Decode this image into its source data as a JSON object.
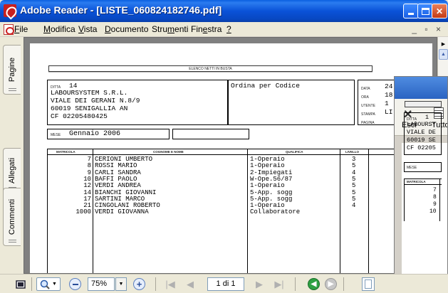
{
  "window": {
    "title": "Adobe Reader - [LISTE_060824182746.pdf]"
  },
  "menu": {
    "items": [
      {
        "prefix": "",
        "key": "F",
        "rest": "ile"
      },
      {
        "prefix": "",
        "key": "M",
        "rest": "odifica"
      },
      {
        "prefix": "",
        "key": "V",
        "rest": "ista"
      },
      {
        "prefix": "",
        "key": "D",
        "rest": "ocumento"
      },
      {
        "prefix": "Stru",
        "key": "m",
        "rest": "enti"
      },
      {
        "prefix": "Fin",
        "key": "e",
        "rest": "stra"
      },
      {
        "prefix": "",
        "key": "?",
        "rest": ""
      }
    ],
    "doc_controls": "_ ▫ ×"
  },
  "sidebar": {
    "tabs": [
      "Pagine",
      "Allegati",
      "Commenti"
    ]
  },
  "document": {
    "header_title": "ELENCO NETTI IN BUSTA",
    "ditta_label": "DITTA",
    "ditta_code": "14",
    "company_lines": [
      "LABOURSYSTEM S.R.L.",
      "VIALE DEI GERANI N.8/9",
      "60019 SENIGALLIA AN",
      "CF 02205480425"
    ],
    "ordina": "Ordina per Codice",
    "right_labels": [
      "DATA",
      "ORA",
      "UTENTE",
      "STAMPA",
      "PAGINA"
    ],
    "right_values": [
      "24",
      "18",
      "1",
      "LI",
      ""
    ],
    "mese_label": "MESE",
    "mese_value": "Gennaio  2006",
    "columns": {
      "matricola": "MATRICOLA",
      "nome": "COGNOME E NOME",
      "qualifica": "QUALIFICA",
      "livello": "LIVELLO"
    },
    "rows": [
      {
        "matricola": "7",
        "nome": "CERIONI UMBERTO",
        "qualifica": "1-Operaio",
        "livello": "3"
      },
      {
        "matricola": "8",
        "nome": "ROSSI MARIO",
        "qualifica": "1-Operaio",
        "livello": "5"
      },
      {
        "matricola": "9",
        "nome": "CARLI SANDRA",
        "qualifica": "2-Impiegati",
        "livello": "4"
      },
      {
        "matricola": "10",
        "nome": "BAFFI PAOLO",
        "qualifica": "W-Ope.56/87",
        "livello": "5"
      },
      {
        "matricola": "12",
        "nome": "VERDI ANDREA",
        "qualifica": "1-Operaio",
        "livello": "5"
      },
      {
        "matricola": "14",
        "nome": "BIANCHI GIOVANNI",
        "qualifica": "5-App. sogg",
        "livello": "5"
      },
      {
        "matricola": "17",
        "nome": "SARTINI MARCO",
        "qualifica": "5-App. sogg",
        "livello": "5"
      },
      {
        "matricola": "21",
        "nome": "CINGOLANI ROBERTO",
        "qualifica": "1-Operaio",
        "livello": "4"
      },
      {
        "matricola": "1000",
        "nome": "VERDI GIOVANNA",
        "qualifica": "Collaboratore",
        "livello": ""
      }
    ]
  },
  "overlay": {
    "esci_label": "Esci",
    "tutto_label": "Tutto",
    "ditta_label": "DITTA",
    "ditta_code": "1",
    "company_lines": [
      "LABOURSY",
      "VIALE DE",
      "60019 SE",
      "CF 02205"
    ],
    "mese_label": "MESE",
    "matricola_label": "MATRICOLA",
    "matricole": [
      "7",
      "8",
      "9",
      "10"
    ]
  },
  "toolbar": {
    "zoom_value": "75%",
    "page_value": "1 di 1"
  },
  "colors": {
    "titlebar": "#0a52d8",
    "close_button": "#c43a16",
    "page_bg": "#808080"
  }
}
